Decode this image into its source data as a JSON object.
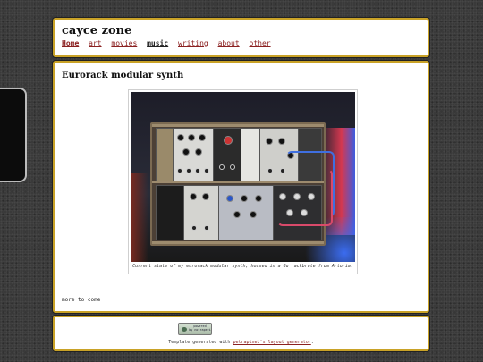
{
  "site": {
    "title": "cayce zone"
  },
  "nav": {
    "items": [
      {
        "label": "Home"
      },
      {
        "label": "art"
      },
      {
        "label": "movies"
      },
      {
        "label": "music"
      },
      {
        "label": "writing"
      },
      {
        "label": "about"
      },
      {
        "label": "other"
      }
    ]
  },
  "post": {
    "title": "Eurorack modular synth",
    "caption": "Current state of my eurorack modular synth, housed in a 6u rackbrute from Arturia.",
    "body": "more to come"
  },
  "footer": {
    "badge_line1": "powered",
    "badge_line2": "by notrapezi",
    "credit_prefix": "Template generated with ",
    "credit_link": "petrapixel's layout generator",
    "credit_suffix": "."
  },
  "colors": {
    "panel_border": "#c9a227",
    "link": "#8b2020",
    "background": "#3a3a3a"
  }
}
